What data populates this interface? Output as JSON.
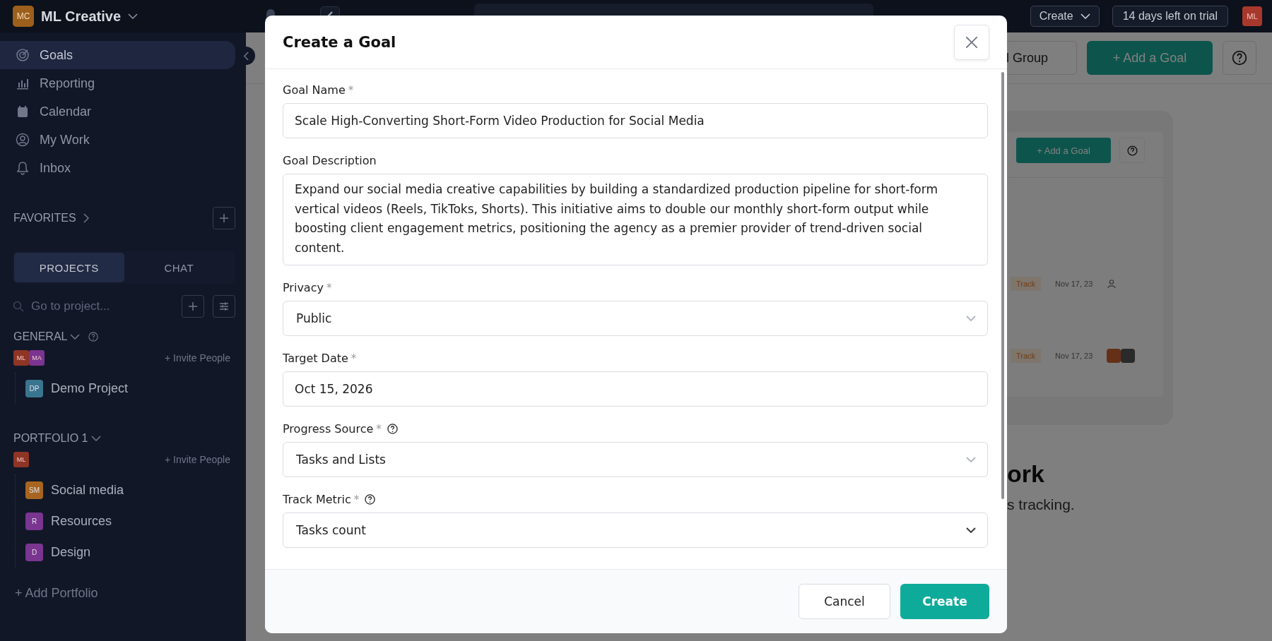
{
  "workspace": {
    "initials": "MC",
    "name": "ML Creative"
  },
  "topbar": {
    "create": "Create",
    "trial": "14 days left on trial",
    "avatar": "ML"
  },
  "sidebar": {
    "nav": [
      {
        "label": "Goals",
        "selected": true
      },
      {
        "label": "Reporting",
        "selected": false
      },
      {
        "label": "Calendar",
        "selected": false
      },
      {
        "label": "My Work",
        "selected": false
      },
      {
        "label": "Inbox",
        "selected": false
      }
    ],
    "favorites": "FAVORITES",
    "tabs": [
      {
        "label": "PROJECTS",
        "selected": true
      },
      {
        "label": "CHAT",
        "selected": false
      }
    ],
    "project_search": {
      "placeholder": "Go to project..."
    },
    "groups": [
      {
        "name": "GENERAL",
        "help": true,
        "invite": "+ Invite People",
        "members": [
          {
            "initials": "ML",
            "color": "#8e3526"
          },
          {
            "initials": "MA",
            "color": "#7a3590"
          }
        ],
        "projects": [
          {
            "initials": "DP",
            "name": "Demo Project",
            "color": "#3a7590"
          }
        ]
      },
      {
        "name": "PORTFOLIO 1",
        "invite": "+ Invite People",
        "members": [
          {
            "initials": "ML",
            "color": "#8e3526"
          }
        ],
        "projects": [
          {
            "initials": "SM",
            "name": "Social media",
            "color": "#a8651f"
          },
          {
            "initials": "R",
            "name": "Resources",
            "color": "#7a3590"
          },
          {
            "initials": "D",
            "name": "Design",
            "color": "#7a3590"
          }
        ]
      }
    ],
    "add_portfolio": "+ Add Portfolio"
  },
  "page": {
    "group_button": "l Group",
    "add_button": "+ Add a Goal",
    "illustration": {
      "add_button": "+ Add a Goal",
      "rows": [
        {
          "status": "Track",
          "date": "Nov 17, 23",
          "kind": "unassigned"
        },
        {
          "status": "Track",
          "date": "Nov 17, 23",
          "kind": "avatars"
        }
      ]
    },
    "empty_title": "ork",
    "empty_text": "s tracking."
  },
  "modal": {
    "title": "Create a Goal",
    "required_mark": "*",
    "fields": [
      {
        "label": "Goal Name",
        "required": true,
        "kind": "text",
        "value": "Scale High-Converting Short-Form Video Production for Social Media"
      },
      {
        "label": "Goal Description",
        "kind": "textarea",
        "value": "Expand our social media creative capabilities by building a standardized production pipeline for short-form vertical videos (Reels, TikToks, Shorts). This initiative aims to double our monthly short-form output while boosting client engagement metrics, positioning the agency as a premier provider of trend-driven social content."
      },
      {
        "label": "Privacy",
        "required": true,
        "kind": "select",
        "value": "Public"
      },
      {
        "label": "Target Date",
        "required": true,
        "kind": "text",
        "value": "Oct 15, 2026"
      },
      {
        "label": "Progress Source",
        "required": true,
        "help": true,
        "kind": "select",
        "value": "Tasks and Lists"
      },
      {
        "label": "Track Metric",
        "required": true,
        "help": true,
        "kind": "select",
        "value": "Tasks count"
      }
    ],
    "buttons": [
      {
        "label": "Cancel",
        "kind": "secondary"
      },
      {
        "label": "Create",
        "kind": "primary"
      }
    ]
  }
}
